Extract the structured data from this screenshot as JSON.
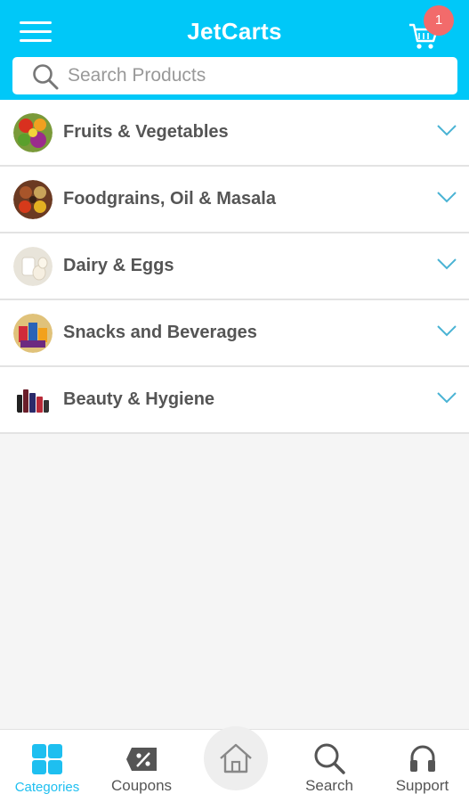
{
  "header": {
    "title": "JetCarts",
    "cart_count": "1",
    "menu_icon": "hamburger-menu-icon",
    "cart_icon": "shopping-cart-icon"
  },
  "search": {
    "placeholder": "Search Products",
    "value": ""
  },
  "categories": [
    {
      "label": "Fruits & Vegetables",
      "icon": "fruits-vegetables-thumbnail"
    },
    {
      "label": "Foodgrains, Oil & Masala",
      "icon": "foodgrains-thumbnail"
    },
    {
      "label": "Dairy & Eggs",
      "icon": "dairy-eggs-thumbnail"
    },
    {
      "label": "Snacks and Beverages",
      "icon": "snacks-beverages-thumbnail"
    },
    {
      "label": "Beauty & Hygiene",
      "icon": "beauty-hygiene-thumbnail"
    }
  ],
  "bottom_nav": {
    "categories": {
      "label": "Categories",
      "active": true
    },
    "coupons": {
      "label": "Coupons"
    },
    "home": {
      "label": ""
    },
    "search": {
      "label": "Search"
    },
    "support": {
      "label": "Support"
    }
  },
  "colors": {
    "accent": "#00c8f8",
    "badge": "#f26b6b",
    "chevron": "#4ab3d4",
    "text": "#555555"
  }
}
